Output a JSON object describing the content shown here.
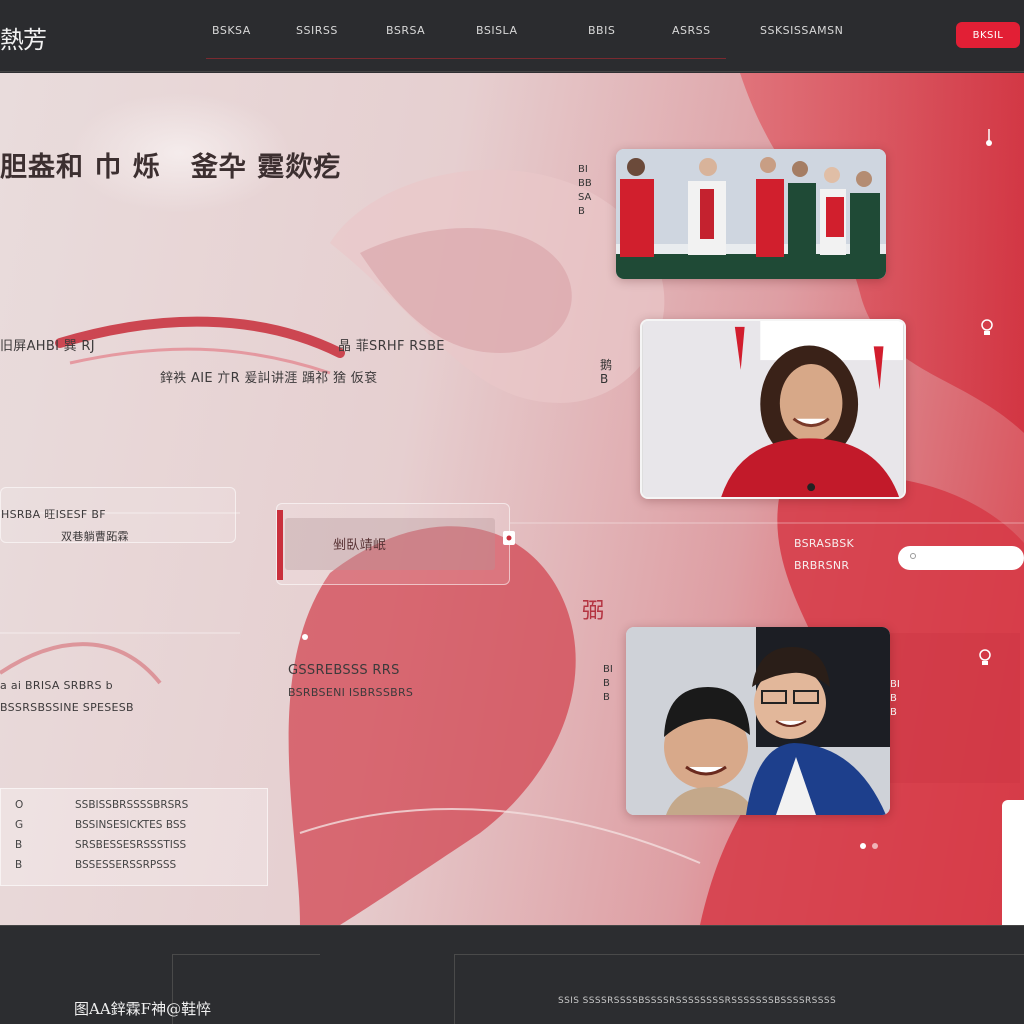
{
  "header": {
    "logo": "熱芳",
    "nav": [
      "BSKSA",
      "SSIRSS",
      "BSRSA",
      "BSISLA",
      "BBIS",
      "ASRSS",
      "SSKSISSAMSN"
    ],
    "cta": "BKSIL"
  },
  "hero": {
    "title_a": "胆盎和 巾 烁",
    "title_b": "釜卆 霆欻疙",
    "left_heading": "旧屏AHBI 巽 RJ",
    "center_heading": "晶 菲SRHF RSBE",
    "center_sub": "鋅袟 AIE 亣R 爰訆讲涯 踽祁 猞 仮袞",
    "card1_title": "HSRBA  旺ISESF BF",
    "card1_sub": "双巷躺曹跖霖",
    "card2_label": "剉臥靖岷",
    "left_row": "a   ai   BRISA   SRBRS b",
    "left_row2": "BSSRSBSSINE SPESESB",
    "mid_heading": "GSSREBSSS  RRS",
    "mid_sub": "BSRBSENI ISBRSSBRS",
    "side_label_1": "BI\nBB\nSA\nB",
    "side_label_2": "鹅\nB",
    "side_label_3": "BI\nB\nB",
    "right_caption_1": "BSRASBSK",
    "right_caption_2": "BRBRSNR",
    "vertical_glyph": "弼",
    "search_placeholder": "",
    "list": [
      {
        "k": "O",
        "v": "SSBISSBRSSSSBRSRS"
      },
      {
        "k": "G",
        "v": "BSSINSESICKTES BSS"
      },
      {
        "k": "B",
        "v": "SRSBESSESRSSSTISS"
      },
      {
        "k": "B",
        "v": "BSSESSERSSRPSSS"
      }
    ]
  },
  "footer": {
    "brand": "图AA鋅霖F神@鞋悴",
    "meta": "SSIS  SSSSRSSSSBSSSSRSSSSSSSSRSSSSSSSBSSSSRSSSS"
  },
  "colors": {
    "accent": "#e21f35",
    "nav_bg": "#2b2c2f",
    "hero_red": "#d8454f"
  }
}
